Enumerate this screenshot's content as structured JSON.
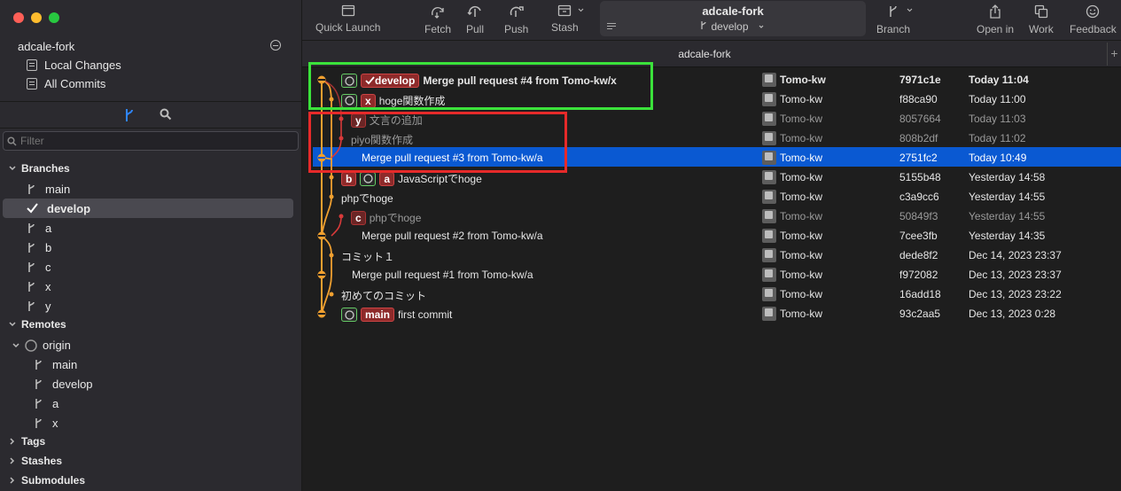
{
  "sidebar": {
    "repo_name": "adcale-fork",
    "nav": [
      {
        "label": "Local Changes"
      },
      {
        "label": "All Commits"
      }
    ],
    "filter_placeholder": "Filter",
    "sections": {
      "branches": "Branches",
      "remotes": "Remotes",
      "tags": "Tags",
      "stashes": "Stashes",
      "submodules": "Submodules"
    },
    "branches": [
      "main",
      "develop",
      "a",
      "b",
      "c",
      "x",
      "y"
    ],
    "current_branch": "develop",
    "remote_name": "origin",
    "remote_branches": [
      "main",
      "develop",
      "a",
      "x"
    ]
  },
  "toolbar": {
    "quick_launch": "Quick Launch",
    "fetch": "Fetch",
    "pull": "Pull",
    "push": "Push",
    "stash": "Stash",
    "repo_title": "adcale-fork",
    "branch_selector": "develop",
    "branch": "Branch",
    "open_in": "Open in",
    "work": "Work",
    "feedback": "Feedback"
  },
  "tab": {
    "title": "adcale-fork"
  },
  "commits": [
    {
      "tags": [
        "gh",
        "develop"
      ],
      "message": "Merge pull request #4 from Tomo-kw/x",
      "author": "Tomo-kw",
      "sha": "7971c1e",
      "date": "Today 11:04",
      "bold": true
    },
    {
      "tags": [
        "gh",
        "x"
      ],
      "message": "hoge関数作成",
      "author": "Tomo-kw",
      "sha": "f88ca90",
      "date": "Today 11:00"
    },
    {
      "tags": [
        "y"
      ],
      "message": "文言の追加",
      "author": "Tomo-kw",
      "sha": "8057664",
      "date": "Today 11:03",
      "dim": true
    },
    {
      "tags": [],
      "message": "piyo関数作成",
      "author": "Tomo-kw",
      "sha": "808b2df",
      "date": "Today 11:02",
      "dim": true
    },
    {
      "tags": [],
      "message": "Merge pull request #3 from Tomo-kw/a",
      "author": "Tomo-kw",
      "sha": "2751fc2",
      "date": "Today 10:49",
      "selected": true
    },
    {
      "tags": [
        "b",
        "gh",
        "a"
      ],
      "message": "JavaScriptでhoge",
      "author": "Tomo-kw",
      "sha": "5155b48",
      "date": "Yesterday 14:58"
    },
    {
      "tags": [],
      "message": "phpでhoge",
      "author": "Tomo-kw",
      "sha": "c3a9cc6",
      "date": "Yesterday 14:55"
    },
    {
      "tags": [
        "c"
      ],
      "message": "phpでhoge",
      "author": "Tomo-kw",
      "sha": "50849f3",
      "date": "Yesterday 14:55",
      "dim": true
    },
    {
      "tags": [],
      "message": "Merge pull request #2 from Tomo-kw/a",
      "author": "Tomo-kw",
      "sha": "7cee3fb",
      "date": "Yesterday 14:35"
    },
    {
      "tags": [],
      "message": "コミット１",
      "author": "Tomo-kw",
      "sha": "dede8f2",
      "date": "Dec 14, 2023 23:37"
    },
    {
      "tags": [],
      "message": "Merge pull request #1 from Tomo-kw/a",
      "author": "Tomo-kw",
      "sha": "f972082",
      "date": "Dec 13, 2023 23:37"
    },
    {
      "tags": [],
      "message": "初めてのコミット",
      "author": "Tomo-kw",
      "sha": "16add18",
      "date": "Dec 13, 2023 23:22"
    },
    {
      "tags": [
        "gh",
        "main"
      ],
      "message": "first commit",
      "author": "Tomo-kw",
      "sha": "93c2aa5",
      "date": "Dec 13, 2023 0:28"
    }
  ],
  "colors": {
    "selection": "#0a59d2",
    "graph_orange": "#f0a030",
    "graph_red": "#d83a3a",
    "highlight_green": "#3be23b",
    "highlight_red": "#e62a2a"
  }
}
